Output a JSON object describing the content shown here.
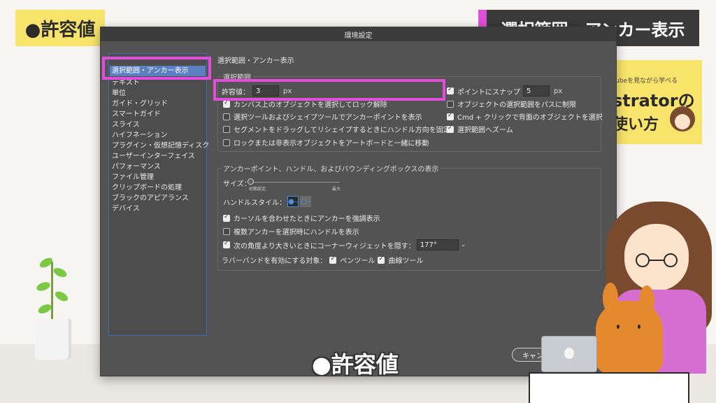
{
  "tags": {
    "left": "●許容値",
    "right": "選択範囲・アンカー表示"
  },
  "book": {
    "top": "Tubeを見ながら学べる",
    "main": "strator",
    "main_suffix": "の",
    "sub": "使い方"
  },
  "dialog": {
    "title": "環境設定",
    "sidebar": {
      "items": [
        "選択範囲・アンカー表示",
        "テキスト",
        "単位",
        "ガイド・グリッド",
        "スマートガイド",
        "スライス",
        "ハイフネーション",
        "プラグイン・仮想記憶ディスク",
        "ユーザーインターフェイス",
        "パフォーマンス",
        "ファイル管理",
        "クリップボードの処理",
        "ブラックのアピアランス",
        "デバイス"
      ]
    },
    "section_title": "選択範囲・アンカー表示",
    "selection": {
      "group_title": "選択範囲",
      "tolerance_label": "許容値：",
      "tolerance_value": "3",
      "tolerance_unit": "px",
      "snap_label": "ポイントにスナップ",
      "snap_value": "5",
      "snap_unit": "px",
      "checkboxes_left": [
        {
          "label": "カンバス上のオブジェクトを選択してロック解除",
          "checked": true
        },
        {
          "label": "選択ツールおよびシェイプツールでアンカーポイントを表示",
          "checked": false
        },
        {
          "label": "セグメントをドラッグしてリシェイプするときにハンドル方向を固定",
          "checked": false
        },
        {
          "label": "ロックまたは非表示オブジェクトをアートボードと一緒に移動",
          "checked": false
        }
      ],
      "checkboxes_right": [
        {
          "label": "オブジェクトの選択範囲をパスに制限",
          "checked": false
        },
        {
          "label": "Cmd + クリックで背面のオブジェクトを選択",
          "checked": true
        },
        {
          "label": "選択範囲へズーム",
          "checked": true
        }
      ]
    },
    "anchor": {
      "group_title": "アンカーポイント、ハンドル、およびバウンディングボックスの表示",
      "size_label": "サイズ：",
      "size_min_label": "初期設定",
      "size_max_label": "最大",
      "size_level": 0,
      "handle_style_label": "ハンドルスタイル：",
      "checkboxes": [
        {
          "label": "カーソルを合わせたときにアンカーを強調表示",
          "checked": true
        },
        {
          "label": "複数アンカーを選択時にハンドルを表示",
          "checked": false
        },
        {
          "label": "次の角度より大きいときにコーナーウィジェットを隠す：",
          "checked": true
        }
      ],
      "angle_value": "177°",
      "rubber_band_label": "ラバーバンドを有効にする対象：",
      "rubber_band": [
        {
          "label": "ペンツール",
          "checked": true
        },
        {
          "label": "曲線ツール",
          "checked": true
        }
      ]
    },
    "cancel_button": "キャンセル"
  },
  "caption": "●許容値",
  "colors": {
    "highlight": "#e24ddc",
    "tag_yellow": "#f8e36b",
    "dialog_bg": "#535353",
    "sidebar_selected": "#5b7fc0"
  }
}
